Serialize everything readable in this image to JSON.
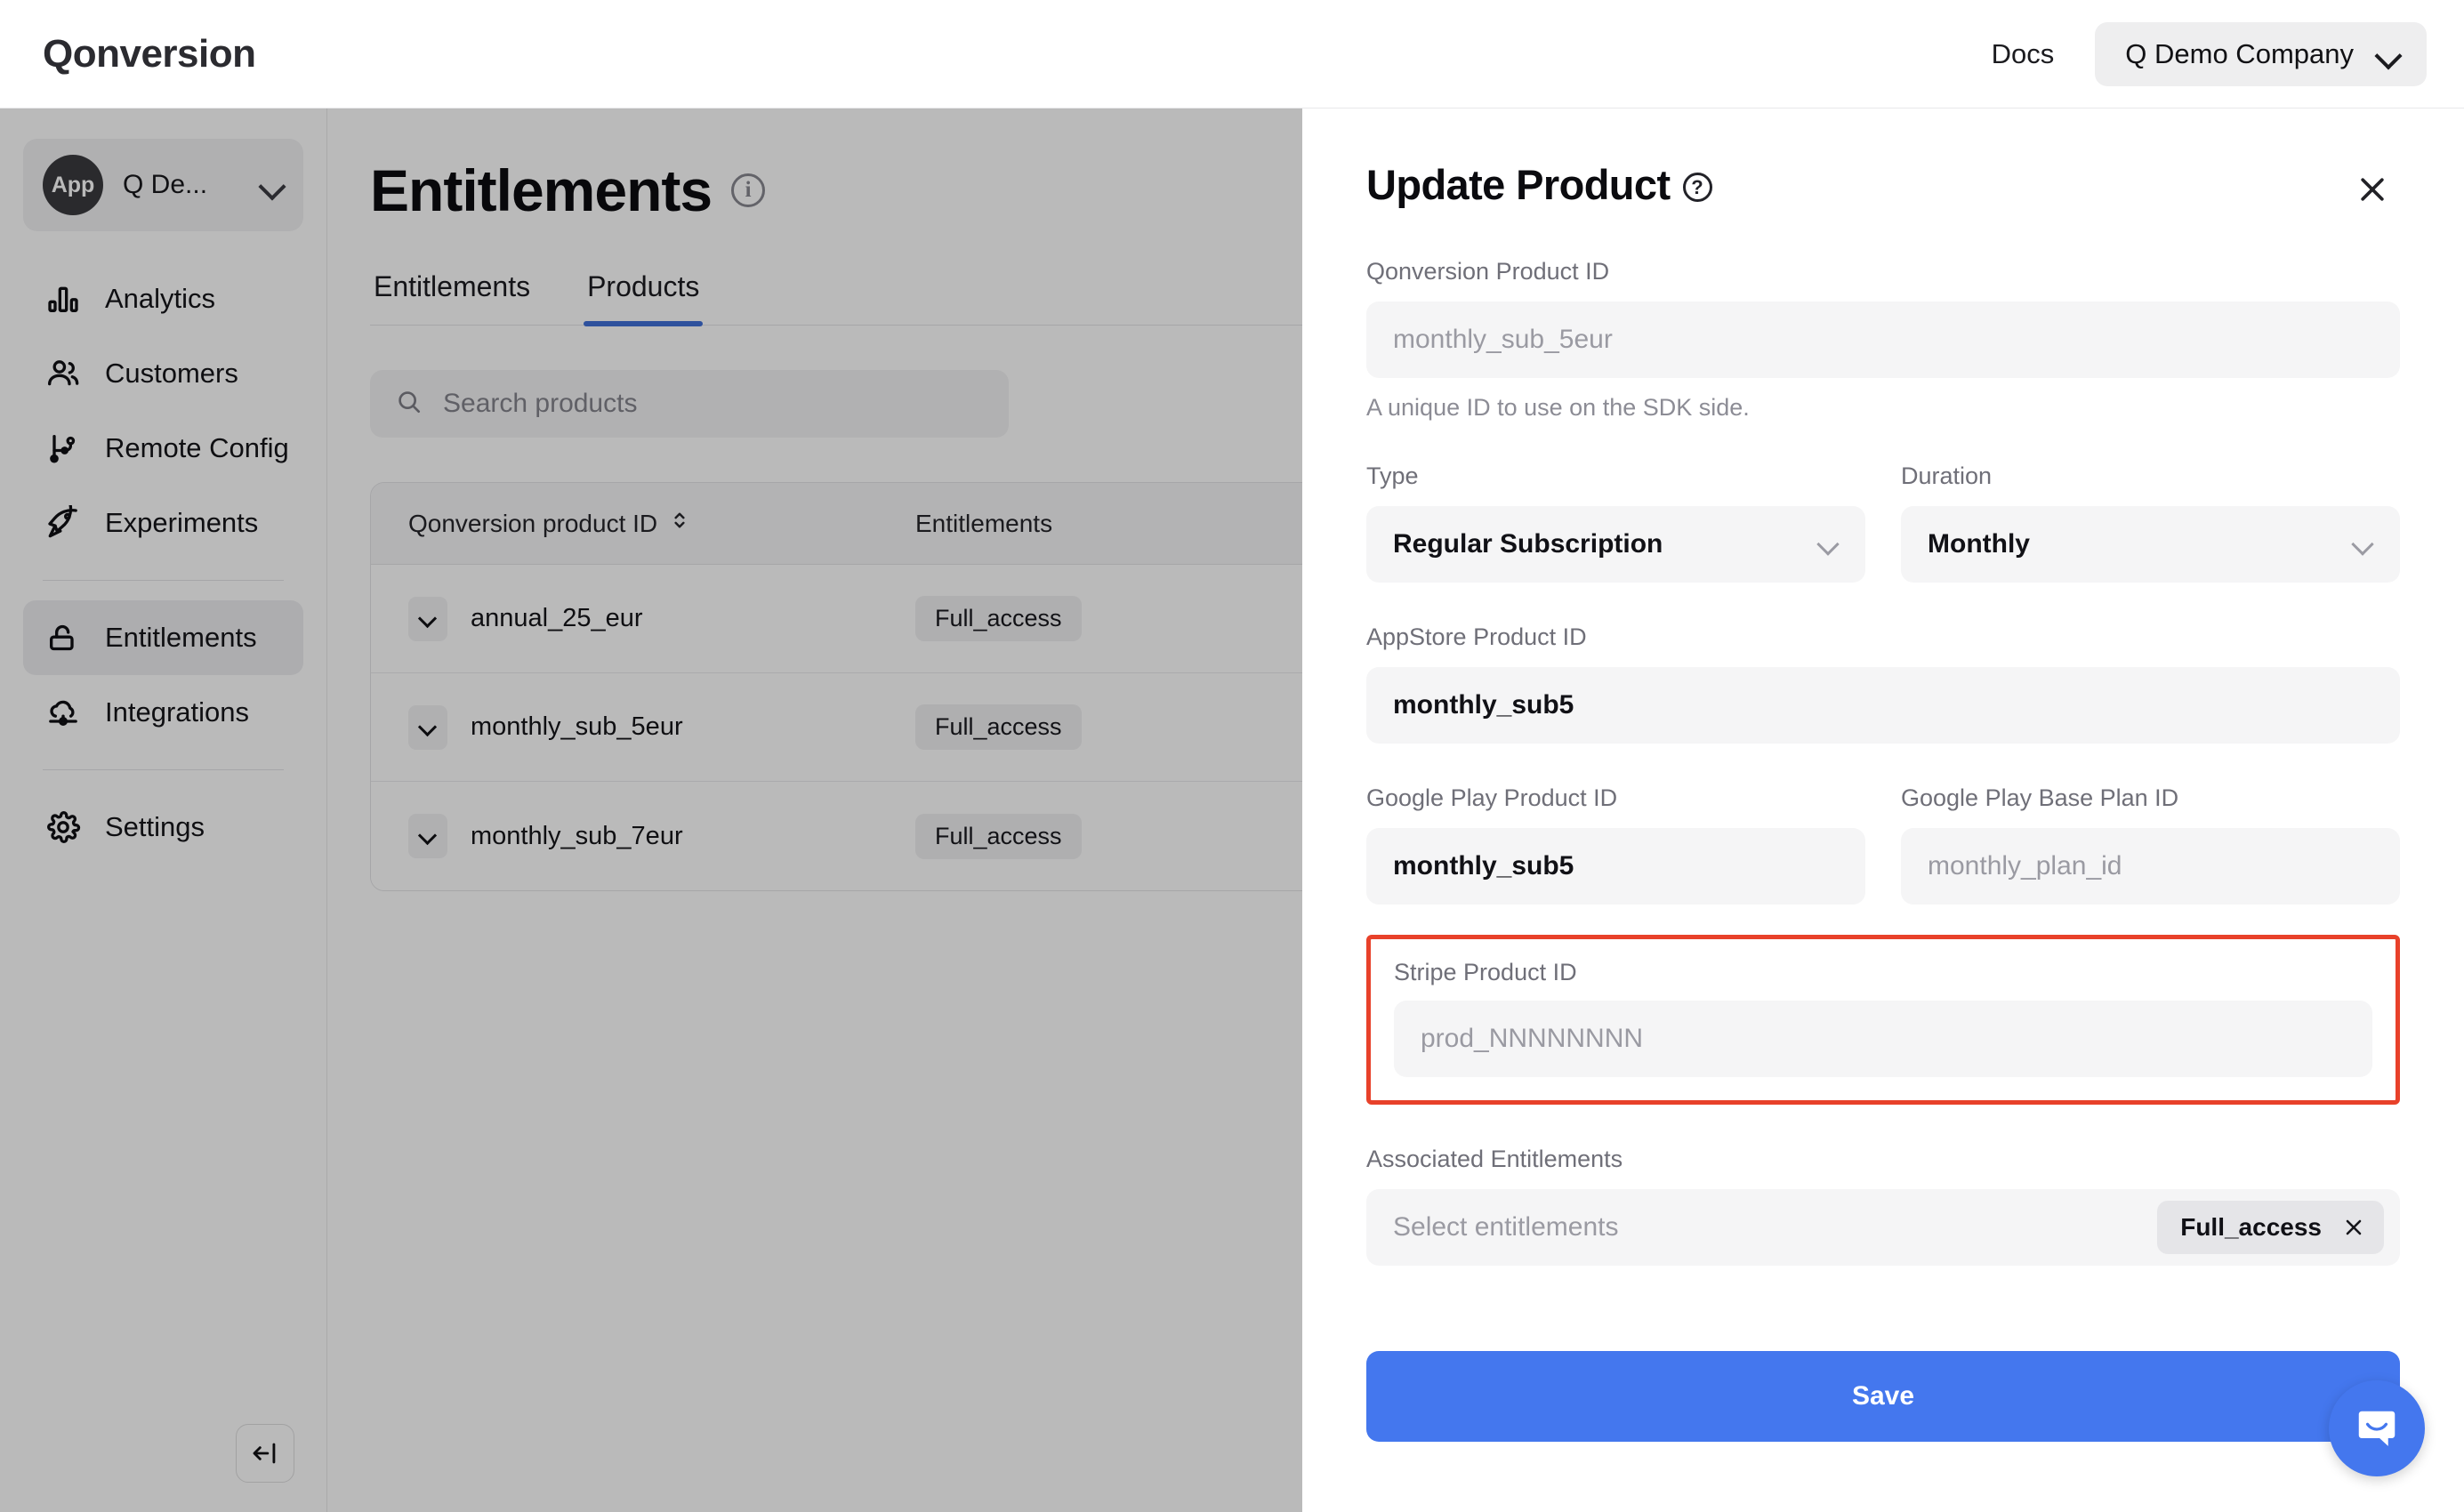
{
  "topbar": {
    "brand": "Qonversion",
    "docs_label": "Docs",
    "company_label": "Q Demo Company",
    "chevron_icon": "chevron-down-icon"
  },
  "sidebar": {
    "app_switcher": {
      "avatar_label": "App",
      "app_name": "Q De...",
      "chevron_icon": "chevron-down-icon"
    },
    "items": [
      {
        "label": "Analytics",
        "icon": "bar-chart-icon",
        "active": false
      },
      {
        "label": "Customers",
        "icon": "users-icon",
        "active": false
      },
      {
        "label": "Remote Config",
        "icon": "git-branch-icon",
        "active": false
      },
      {
        "label": "Experiments",
        "icon": "rocket-icon",
        "active": false
      },
      {
        "label": "Entitlements",
        "icon": "lock-open-icon",
        "active": true
      },
      {
        "label": "Integrations",
        "icon": "cloud-plug-icon",
        "active": false
      },
      {
        "label": "Settings",
        "icon": "gear-icon",
        "active": false
      }
    ],
    "collapse_icon": "collapse-sidebar-icon"
  },
  "main": {
    "page_title": "Entitlements",
    "page_title_icon": "info-circle-icon",
    "tabs": [
      {
        "label": "Entitlements",
        "active": false
      },
      {
        "label": "Products",
        "active": true
      }
    ],
    "search": {
      "placeholder": "Search products",
      "value": "",
      "icon": "search-icon"
    },
    "table": {
      "columns": [
        {
          "label": "Qonversion product ID",
          "sortable": true,
          "sort_icon": "sort-arrows-icon"
        },
        {
          "label": "Entitlements",
          "sortable": false
        }
      ],
      "rows": [
        {
          "product_id": "annual_25_eur",
          "entitlement": "Full_access",
          "expand_icon": "chevron-down-icon"
        },
        {
          "product_id": "monthly_sub_5eur",
          "entitlement": "Full_access",
          "expand_icon": "chevron-down-icon"
        },
        {
          "product_id": "monthly_sub_7eur",
          "entitlement": "Full_access",
          "expand_icon": "chevron-down-icon"
        }
      ]
    }
  },
  "drawer": {
    "title": "Update Product",
    "title_icon": "question-circle-icon",
    "close_icon": "close-icon",
    "qonversion_product_id": {
      "label": "Qonversion Product ID",
      "placeholder": "monthly_sub_5eur",
      "value": "",
      "help": "A unique ID to use on the SDK side."
    },
    "type": {
      "label": "Type",
      "value": "Regular Subscription",
      "chevron_icon": "chevron-down-icon"
    },
    "duration": {
      "label": "Duration",
      "value": "Monthly",
      "chevron_icon": "chevron-down-icon"
    },
    "appstore_product_id": {
      "label": "AppStore Product ID",
      "value": "monthly_sub5"
    },
    "google_play_product_id": {
      "label": "Google Play Product ID",
      "value": "monthly_sub5"
    },
    "google_play_base_plan_id": {
      "label": "Google Play Base Plan ID",
      "placeholder": "monthly_plan_id",
      "value": ""
    },
    "stripe_product_id": {
      "label": "Stripe Product ID",
      "placeholder": "prod_NNNNNNNN",
      "value": "",
      "highlighted": true,
      "highlight_color": "#e8412a"
    },
    "associated_entitlements": {
      "label": "Associated Entitlements",
      "placeholder": "Select entitlements",
      "chips": [
        {
          "label": "Full_access",
          "remove_icon": "close-icon"
        }
      ]
    },
    "save_label": "Save"
  },
  "intercom": {
    "icon": "intercom-messenger-icon"
  },
  "colors": {
    "accent_blue": "#4477ee",
    "tab_underline": "#3f6fd8",
    "annotation_red": "#e8412a",
    "field_bg": "#f5f5f6"
  }
}
